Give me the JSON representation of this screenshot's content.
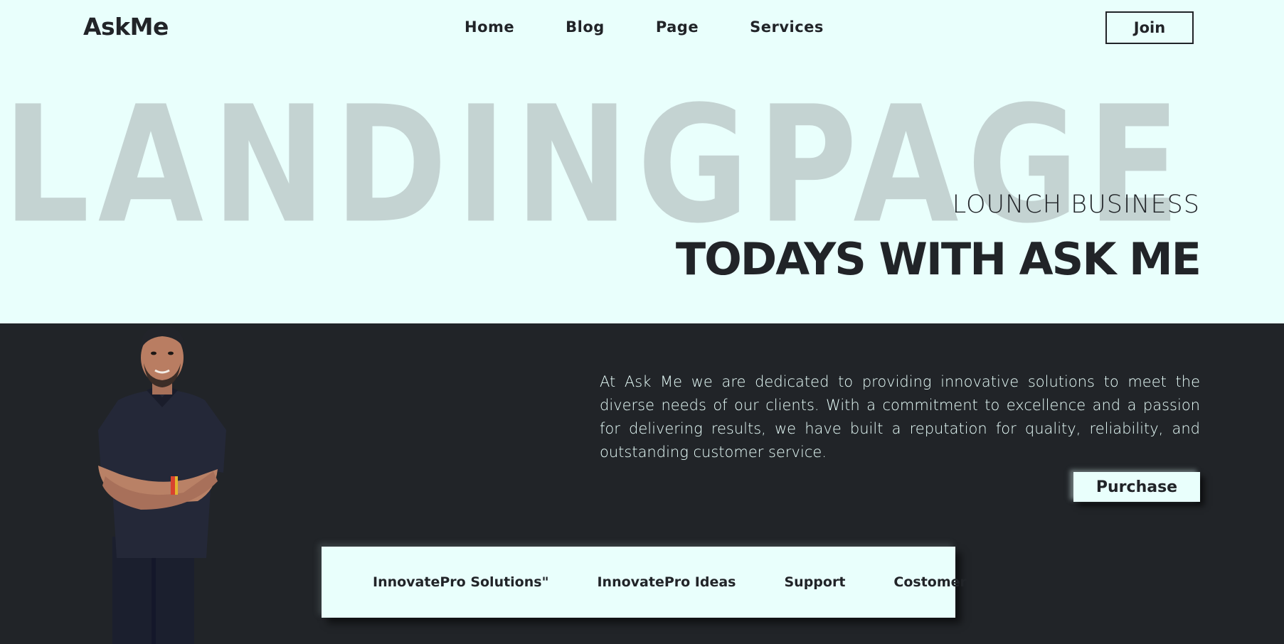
{
  "brand": {
    "logo": "AskMe"
  },
  "nav": {
    "items": [
      {
        "label": "Home"
      },
      {
        "label": "Blog"
      },
      {
        "label": "Page"
      },
      {
        "label": "Services"
      }
    ],
    "join_label": "Join"
  },
  "hero": {
    "watermark": "LANDINGPAGE",
    "subtitle": "LOUNCH BUSINESS",
    "title": "TODAYS WITH ASK ME"
  },
  "about": {
    "description": "At Ask Me we are dedicated to providing innovative solutions to meet the diverse needs of our clients. With a commitment to excellence and a passion for delivering results, we have built a reputation for quality, reliability, and outstanding customer service.",
    "purchase_label": "Purchase"
  },
  "features": {
    "items": [
      {
        "label": "InnovatePro Solutions\""
      },
      {
        "label": "InnovatePro Ideas"
      },
      {
        "label": "Support"
      },
      {
        "label": "Costomer"
      }
    ]
  },
  "colors": {
    "light_bg": "#e9fffc",
    "dark_bg": "#212428",
    "watermark": "#c4d3d2",
    "text_dark": "#212428"
  }
}
